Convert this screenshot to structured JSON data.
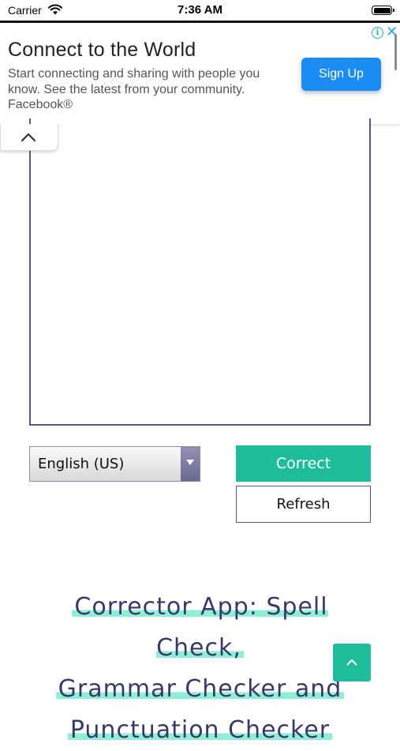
{
  "status_bar": {
    "carrier": "Carrier",
    "time": "7:36 AM"
  },
  "ad": {
    "title": "Connect to the World",
    "description": "Start connecting and sharing with people you know. See the latest from your community. Facebook®",
    "cta_label": "Sign Up",
    "info_icon": "i",
    "close_icon": "✕",
    "colors": {
      "cta": "#1a8cf3",
      "icons": "#2aa6e0"
    }
  },
  "editor": {
    "text": "",
    "language_selected": "English (US)",
    "correct_label": "Correct",
    "refresh_label": "Refresh",
    "colors": {
      "primary": "#1fbc9c",
      "border": "#5b5487"
    }
  },
  "heading": {
    "lines": [
      "Corrector App: Spell Check,",
      "Grammar Checker and",
      "Punctuation Checker"
    ],
    "colors": {
      "text": "#3a3869",
      "highlight": "#8eefd6"
    }
  },
  "icons": {
    "wifi": "wifi-icon",
    "battery": "battery-icon",
    "collapse": "chevron-up-icon",
    "back_to_top": "chevron-up-icon"
  }
}
